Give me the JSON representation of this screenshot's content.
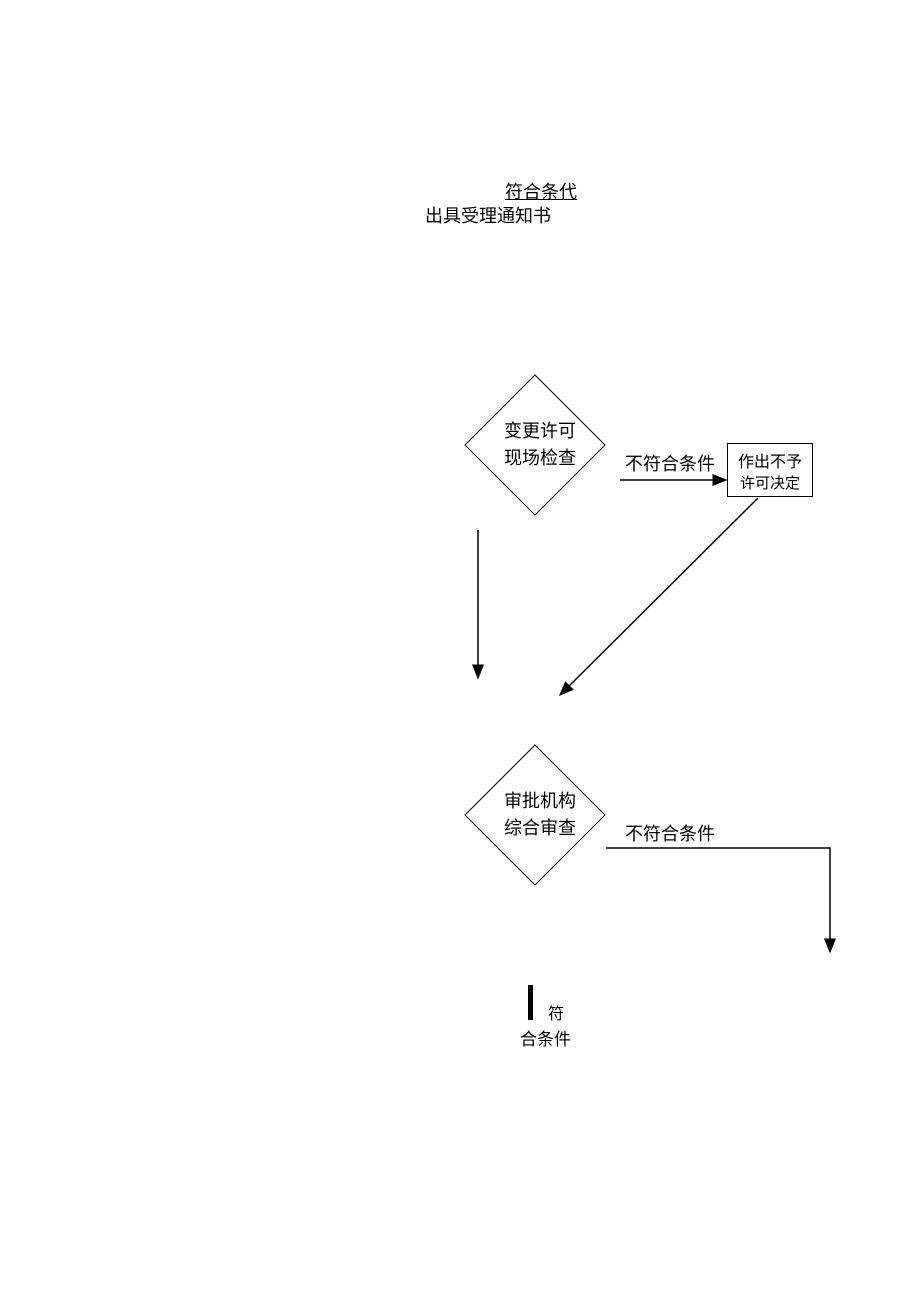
{
  "header": {
    "title_underlined": "符合条代",
    "subtitle": "出具受理通知书"
  },
  "diamond1": {
    "line1": "变更许可",
    "line2": "现场检查"
  },
  "edge1_label": "不符合条件",
  "rect1": {
    "line1": "作出不予",
    "line2": "许可决定"
  },
  "diamond2": {
    "line1": "审批机构",
    "line2": "综合审查"
  },
  "edge2_label": "不符合条件",
  "bottom": {
    "part1": "符",
    "part2": "合条件"
  }
}
